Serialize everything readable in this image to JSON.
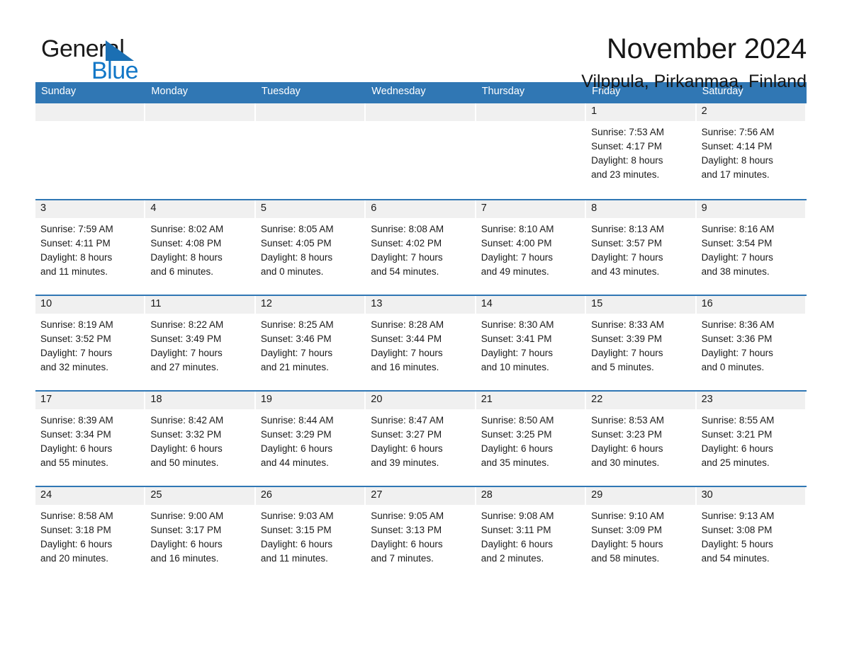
{
  "logo": {
    "word_one": "General",
    "word_two": "Blue",
    "triangle_color": "#1b6fb3",
    "blue_color": "#1277c7"
  },
  "header": {
    "title": "November 2024",
    "subtitle": "Vilppula, Pirkanmaa, Finland"
  },
  "theme": {
    "header_row_bg": "#3077b4",
    "day_band_bg": "#f0f0f0",
    "separator": "#3077b4"
  },
  "weekdays": [
    "Sunday",
    "Monday",
    "Tuesday",
    "Wednesday",
    "Thursday",
    "Friday",
    "Saturday"
  ],
  "weeks": [
    [
      {
        "day": "",
        "empty": true
      },
      {
        "day": "",
        "empty": true
      },
      {
        "day": "",
        "empty": true
      },
      {
        "day": "",
        "empty": true
      },
      {
        "day": "",
        "empty": true
      },
      {
        "day": "1",
        "sunrise": "Sunrise: 7:53 AM",
        "sunset": "Sunset: 4:17 PM",
        "daylight_1": "Daylight: 8 hours",
        "daylight_2": "and 23 minutes."
      },
      {
        "day": "2",
        "sunrise": "Sunrise: 7:56 AM",
        "sunset": "Sunset: 4:14 PM",
        "daylight_1": "Daylight: 8 hours",
        "daylight_2": "and 17 minutes."
      }
    ],
    [
      {
        "day": "3",
        "sunrise": "Sunrise: 7:59 AM",
        "sunset": "Sunset: 4:11 PM",
        "daylight_1": "Daylight: 8 hours",
        "daylight_2": "and 11 minutes."
      },
      {
        "day": "4",
        "sunrise": "Sunrise: 8:02 AM",
        "sunset": "Sunset: 4:08 PM",
        "daylight_1": "Daylight: 8 hours",
        "daylight_2": "and 6 minutes."
      },
      {
        "day": "5",
        "sunrise": "Sunrise: 8:05 AM",
        "sunset": "Sunset: 4:05 PM",
        "daylight_1": "Daylight: 8 hours",
        "daylight_2": "and 0 minutes."
      },
      {
        "day": "6",
        "sunrise": "Sunrise: 8:08 AM",
        "sunset": "Sunset: 4:02 PM",
        "daylight_1": "Daylight: 7 hours",
        "daylight_2": "and 54 minutes."
      },
      {
        "day": "7",
        "sunrise": "Sunrise: 8:10 AM",
        "sunset": "Sunset: 4:00 PM",
        "daylight_1": "Daylight: 7 hours",
        "daylight_2": "and 49 minutes."
      },
      {
        "day": "8",
        "sunrise": "Sunrise: 8:13 AM",
        "sunset": "Sunset: 3:57 PM",
        "daylight_1": "Daylight: 7 hours",
        "daylight_2": "and 43 minutes."
      },
      {
        "day": "9",
        "sunrise": "Sunrise: 8:16 AM",
        "sunset": "Sunset: 3:54 PM",
        "daylight_1": "Daylight: 7 hours",
        "daylight_2": "and 38 minutes."
      }
    ],
    [
      {
        "day": "10",
        "sunrise": "Sunrise: 8:19 AM",
        "sunset": "Sunset: 3:52 PM",
        "daylight_1": "Daylight: 7 hours",
        "daylight_2": "and 32 minutes."
      },
      {
        "day": "11",
        "sunrise": "Sunrise: 8:22 AM",
        "sunset": "Sunset: 3:49 PM",
        "daylight_1": "Daylight: 7 hours",
        "daylight_2": "and 27 minutes."
      },
      {
        "day": "12",
        "sunrise": "Sunrise: 8:25 AM",
        "sunset": "Sunset: 3:46 PM",
        "daylight_1": "Daylight: 7 hours",
        "daylight_2": "and 21 minutes."
      },
      {
        "day": "13",
        "sunrise": "Sunrise: 8:28 AM",
        "sunset": "Sunset: 3:44 PM",
        "daylight_1": "Daylight: 7 hours",
        "daylight_2": "and 16 minutes."
      },
      {
        "day": "14",
        "sunrise": "Sunrise: 8:30 AM",
        "sunset": "Sunset: 3:41 PM",
        "daylight_1": "Daylight: 7 hours",
        "daylight_2": "and 10 minutes."
      },
      {
        "day": "15",
        "sunrise": "Sunrise: 8:33 AM",
        "sunset": "Sunset: 3:39 PM",
        "daylight_1": "Daylight: 7 hours",
        "daylight_2": "and 5 minutes."
      },
      {
        "day": "16",
        "sunrise": "Sunrise: 8:36 AM",
        "sunset": "Sunset: 3:36 PM",
        "daylight_1": "Daylight: 7 hours",
        "daylight_2": "and 0 minutes."
      }
    ],
    [
      {
        "day": "17",
        "sunrise": "Sunrise: 8:39 AM",
        "sunset": "Sunset: 3:34 PM",
        "daylight_1": "Daylight: 6 hours",
        "daylight_2": "and 55 minutes."
      },
      {
        "day": "18",
        "sunrise": "Sunrise: 8:42 AM",
        "sunset": "Sunset: 3:32 PM",
        "daylight_1": "Daylight: 6 hours",
        "daylight_2": "and 50 minutes."
      },
      {
        "day": "19",
        "sunrise": "Sunrise: 8:44 AM",
        "sunset": "Sunset: 3:29 PM",
        "daylight_1": "Daylight: 6 hours",
        "daylight_2": "and 44 minutes."
      },
      {
        "day": "20",
        "sunrise": "Sunrise: 8:47 AM",
        "sunset": "Sunset: 3:27 PM",
        "daylight_1": "Daylight: 6 hours",
        "daylight_2": "and 39 minutes."
      },
      {
        "day": "21",
        "sunrise": "Sunrise: 8:50 AM",
        "sunset": "Sunset: 3:25 PM",
        "daylight_1": "Daylight: 6 hours",
        "daylight_2": "and 35 minutes."
      },
      {
        "day": "22",
        "sunrise": "Sunrise: 8:53 AM",
        "sunset": "Sunset: 3:23 PM",
        "daylight_1": "Daylight: 6 hours",
        "daylight_2": "and 30 minutes."
      },
      {
        "day": "23",
        "sunrise": "Sunrise: 8:55 AM",
        "sunset": "Sunset: 3:21 PM",
        "daylight_1": "Daylight: 6 hours",
        "daylight_2": "and 25 minutes."
      }
    ],
    [
      {
        "day": "24",
        "sunrise": "Sunrise: 8:58 AM",
        "sunset": "Sunset: 3:18 PM",
        "daylight_1": "Daylight: 6 hours",
        "daylight_2": "and 20 minutes."
      },
      {
        "day": "25",
        "sunrise": "Sunrise: 9:00 AM",
        "sunset": "Sunset: 3:17 PM",
        "daylight_1": "Daylight: 6 hours",
        "daylight_2": "and 16 minutes."
      },
      {
        "day": "26",
        "sunrise": "Sunrise: 9:03 AM",
        "sunset": "Sunset: 3:15 PM",
        "daylight_1": "Daylight: 6 hours",
        "daylight_2": "and 11 minutes."
      },
      {
        "day": "27",
        "sunrise": "Sunrise: 9:05 AM",
        "sunset": "Sunset: 3:13 PM",
        "daylight_1": "Daylight: 6 hours",
        "daylight_2": "and 7 minutes."
      },
      {
        "day": "28",
        "sunrise": "Sunrise: 9:08 AM",
        "sunset": "Sunset: 3:11 PM",
        "daylight_1": "Daylight: 6 hours",
        "daylight_2": "and 2 minutes."
      },
      {
        "day": "29",
        "sunrise": "Sunrise: 9:10 AM",
        "sunset": "Sunset: 3:09 PM",
        "daylight_1": "Daylight: 5 hours",
        "daylight_2": "and 58 minutes."
      },
      {
        "day": "30",
        "sunrise": "Sunrise: 9:13 AM",
        "sunset": "Sunset: 3:08 PM",
        "daylight_1": "Daylight: 5 hours",
        "daylight_2": "and 54 minutes."
      }
    ]
  ]
}
